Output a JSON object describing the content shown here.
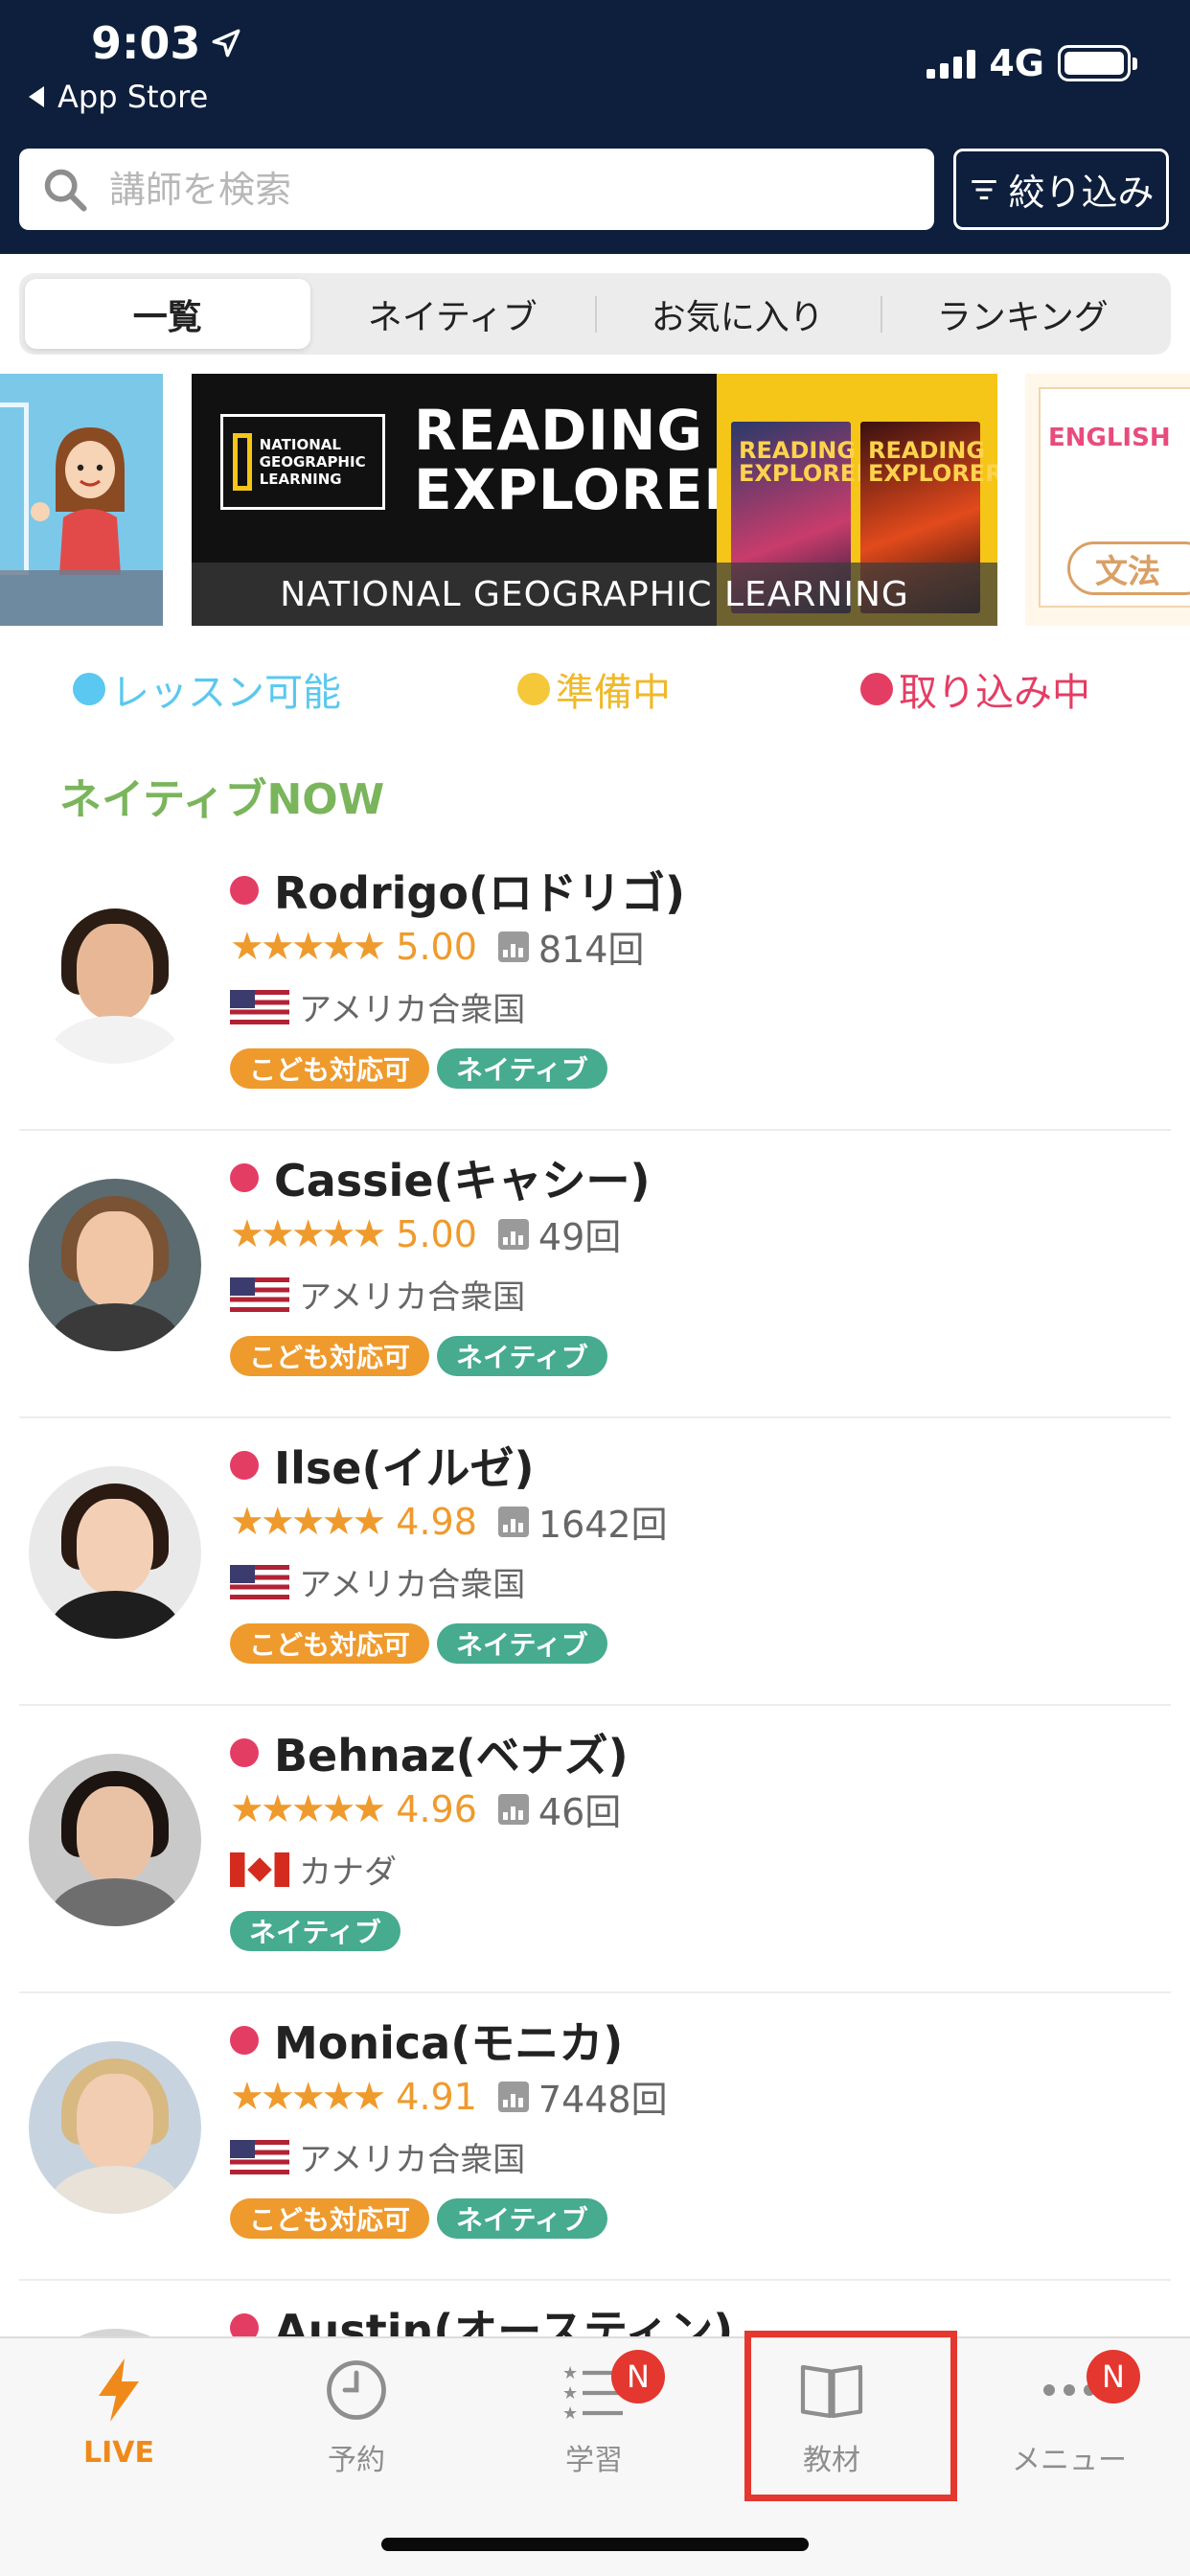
{
  "status_bar": {
    "time": "9:03",
    "back_label": "App Store",
    "network": "4G"
  },
  "search": {
    "placeholder": "講師を検索",
    "filter_label": "絞り込み"
  },
  "tabs": [
    {
      "label": "一覧",
      "active": true
    },
    {
      "label": "ネイティブ",
      "active": false
    },
    {
      "label": "お気に入り",
      "active": false
    },
    {
      "label": "ランキング",
      "active": false
    }
  ],
  "banner": {
    "logo_text": "NATIONAL GEOGRAPHIC LEARNING",
    "title": "READING EXPLORER",
    "book_title": "READING EXPLORER",
    "caption": "NATIONAL GEOGRAPHIC LEARNING",
    "right_word": "ENGLISH",
    "right_badge": "文法"
  },
  "legend": [
    {
      "label": "レッスン可能",
      "color": "#5ac8f0"
    },
    {
      "label": "準備中",
      "color": "#f5c83a"
    },
    {
      "label": "取り込み中",
      "color": "#e43d64"
    }
  ],
  "section_title": "ネイティブNOW",
  "teachers": [
    {
      "name": "Rodrigo(ロドリゴ)",
      "stars": "★★★★★",
      "rating": "5.00",
      "lessons": "814回",
      "country": "アメリカ合衆国",
      "flag": "us",
      "tags": [
        "こども対応可",
        "ネイティブ"
      ],
      "status_color": "#e43d64"
    },
    {
      "name": "Cassie(キャシー)",
      "stars": "★★★★★",
      "rating": "5.00",
      "lessons": "49回",
      "country": "アメリカ合衆国",
      "flag": "us",
      "tags": [
        "こども対応可",
        "ネイティブ"
      ],
      "status_color": "#e43d64"
    },
    {
      "name": "Ilse(イルゼ)",
      "stars": "★★★★★",
      "rating": "4.98",
      "lessons": "1642回",
      "country": "アメリカ合衆国",
      "flag": "us",
      "tags": [
        "こども対応可",
        "ネイティブ"
      ],
      "status_color": "#e43d64"
    },
    {
      "name": "Behnaz(ベナズ)",
      "stars": "★★★★★",
      "rating": "4.96",
      "lessons": "46回",
      "country": "カナダ",
      "flag": "ca",
      "tags": [
        "ネイティブ"
      ],
      "status_color": "#e43d64"
    },
    {
      "name": "Monica(モニカ)",
      "stars": "★★★★★",
      "rating": "4.91",
      "lessons": "7448回",
      "country": "アメリカ合衆国",
      "flag": "us",
      "tags": [
        "こども対応可",
        "ネイティブ"
      ],
      "status_color": "#e43d64"
    },
    {
      "name": "Austin(オースティン)",
      "stars": "",
      "rating": "",
      "lessons": "",
      "country": "",
      "flag": "",
      "tags": [],
      "status_color": "#e43d64"
    }
  ],
  "tabbar": [
    {
      "label": "LIVE",
      "icon": "lightning-icon",
      "active": true,
      "badge": ""
    },
    {
      "label": "予約",
      "icon": "clock-icon",
      "active": false,
      "badge": ""
    },
    {
      "label": "学習",
      "icon": "list-icon",
      "active": false,
      "badge": "N"
    },
    {
      "label": "教材",
      "icon": "book-icon",
      "active": false,
      "badge": "",
      "highlighted": true
    },
    {
      "label": "メニュー",
      "icon": "more-icon",
      "active": false,
      "badge": "N"
    }
  ],
  "colors": {
    "header_bg": "#0d1f3c",
    "accent_orange": "#ef9a2c",
    "native_green": "#46ab8f",
    "section_green": "#7ab55c",
    "highlight_red": "#e4372f"
  }
}
